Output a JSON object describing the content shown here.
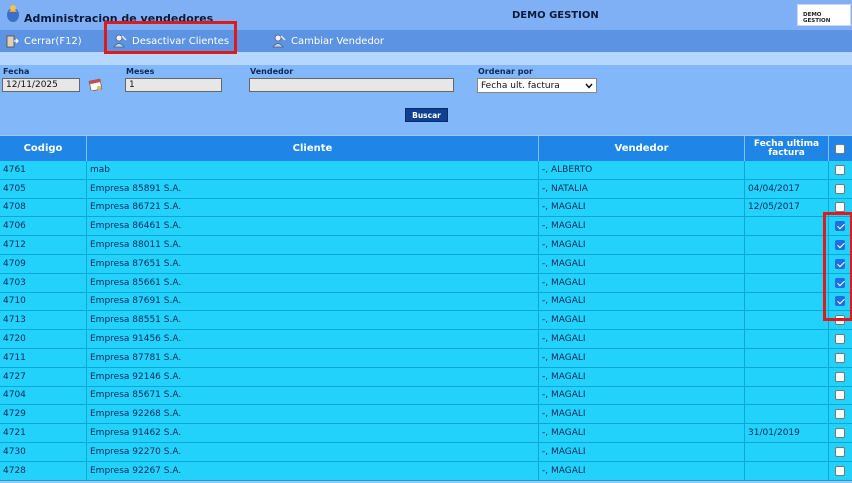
{
  "window": {
    "title": "Administracion de vendedores",
    "center_title": "DEMO GESTION",
    "logo_text": "DEMO GESTION"
  },
  "toolbar": {
    "close_label": "Cerrar(F12)",
    "deactivate_label": "Desactivar Clientes",
    "change_seller_label": "Cambiar Vendedor"
  },
  "filters": {
    "fecha_label": "Fecha",
    "fecha_value": "12/11/2025",
    "meses_label": "Meses",
    "meses_value": "1",
    "vendedor_label": "Vendedor",
    "vendedor_value": "",
    "ordenar_label": "Ordenar por",
    "ordenar_value": "Fecha ult. factura",
    "buscar_label": "Buscar"
  },
  "table": {
    "headers": {
      "codigo": "Codigo",
      "cliente": "Cliente",
      "vendedor": "Vendedor",
      "fecha_line1": "Fecha ultima",
      "fecha_line2": "factura"
    },
    "rows": [
      {
        "codigo": "4761",
        "cliente": "mab",
        "vendedor": "-, ALBERTO",
        "fecha": "",
        "checked": false
      },
      {
        "codigo": "4705",
        "cliente": "Empresa 85891 S.A.",
        "vendedor": "-, NATALIA",
        "fecha": "04/04/2017",
        "checked": false
      },
      {
        "codigo": "4708",
        "cliente": "Empresa 86721 S.A.",
        "vendedor": "-, MAGALI",
        "fecha": "12/05/2017",
        "checked": false
      },
      {
        "codigo": "4706",
        "cliente": "Empresa 86461 S.A.",
        "vendedor": "-, MAGALI",
        "fecha": "",
        "checked": true
      },
      {
        "codigo": "4712",
        "cliente": "Empresa 88011 S.A.",
        "vendedor": "-, MAGALI",
        "fecha": "",
        "checked": true
      },
      {
        "codigo": "4709",
        "cliente": "Empresa 87651 S.A.",
        "vendedor": "-, MAGALI",
        "fecha": "",
        "checked": true
      },
      {
        "codigo": "4703",
        "cliente": "Empresa 85661 S.A.",
        "vendedor": "-, MAGALI",
        "fecha": "",
        "checked": true
      },
      {
        "codigo": "4710",
        "cliente": "Empresa 87691 S.A.",
        "vendedor": "-, MAGALI",
        "fecha": "",
        "checked": true
      },
      {
        "codigo": "4713",
        "cliente": "Empresa 88551 S.A.",
        "vendedor": "-, MAGALI",
        "fecha": "",
        "checked": false
      },
      {
        "codigo": "4720",
        "cliente": "Empresa 91456 S.A.",
        "vendedor": "-, MAGALI",
        "fecha": "",
        "checked": false
      },
      {
        "codigo": "4711",
        "cliente": "Empresa 87781 S.A.",
        "vendedor": "-, MAGALI",
        "fecha": "",
        "checked": false
      },
      {
        "codigo": "4727",
        "cliente": "Empresa 92146 S.A.",
        "vendedor": "-, MAGALI",
        "fecha": "",
        "checked": false
      },
      {
        "codigo": "4704",
        "cliente": "Empresa 85671 S.A.",
        "vendedor": "-, MAGALI",
        "fecha": "",
        "checked": false
      },
      {
        "codigo": "4729",
        "cliente": "Empresa 92268 S.A.",
        "vendedor": "-, MAGALI",
        "fecha": "",
        "checked": false
      },
      {
        "codigo": "4721",
        "cliente": "Empresa 91462 S.A.",
        "vendedor": "-, MAGALI",
        "fecha": "31/01/2019",
        "checked": false
      },
      {
        "codigo": "4730",
        "cliente": "Empresa 92270 S.A.",
        "vendedor": "-, MAGALI",
        "fecha": "",
        "checked": false
      },
      {
        "codigo": "4728",
        "cliente": "Empresa 92267 S.A.",
        "vendedor": "-, MAGALI",
        "fecha": "",
        "checked": false
      }
    ]
  },
  "icons": {
    "app": "app-logo-icon",
    "close": "door-exit-icon",
    "deactivate": "seller-icon",
    "change_seller": "seller-icon",
    "calendar": "calendar-icon"
  },
  "colors": {
    "header_bar": "#1f86e8",
    "row_bg": "#22d2fb",
    "toolbar": "#5c93e3",
    "highlight": "#e01919",
    "checkbox_checked": "#1f6fe0"
  }
}
